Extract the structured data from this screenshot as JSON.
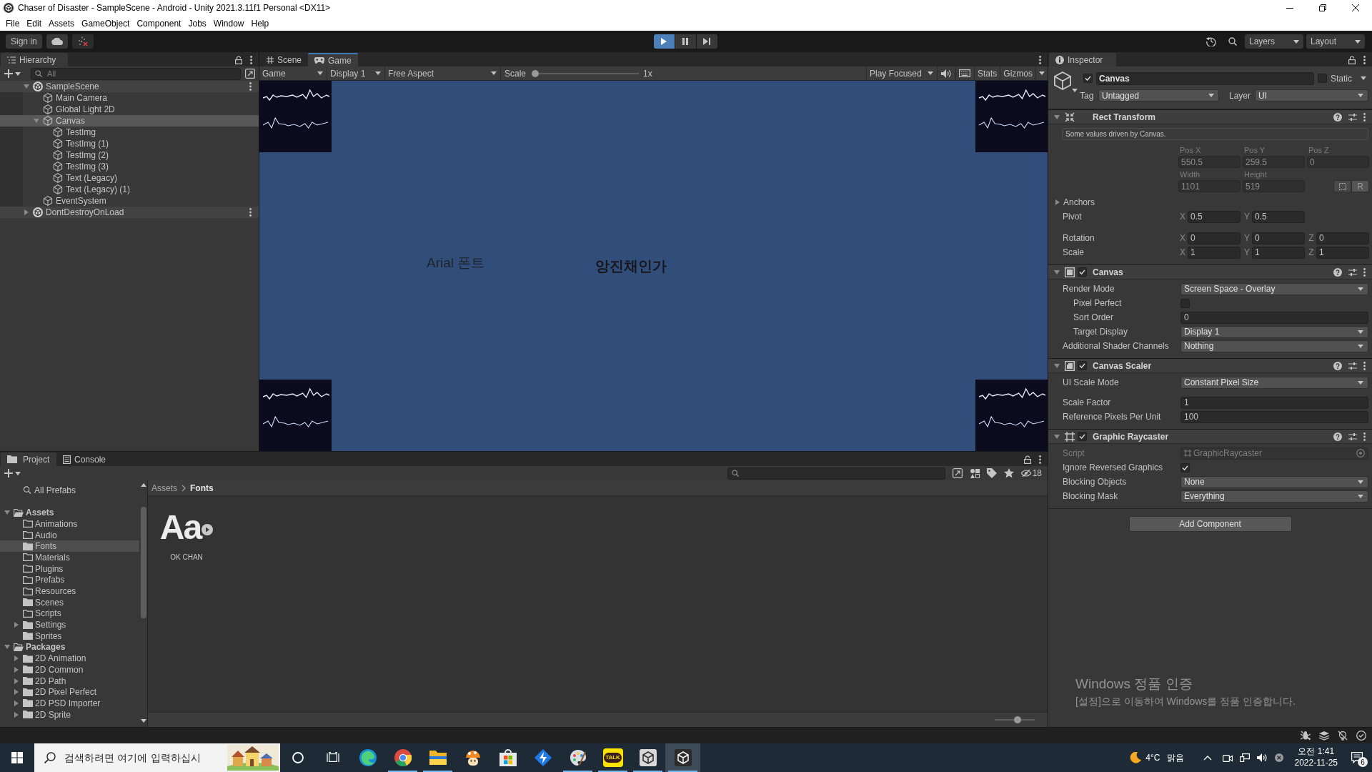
{
  "window": {
    "title": "Chaser of Disaster - SampleScene - Android - Unity 2021.3.11f1 Personal <DX11>"
  },
  "menu": [
    "File",
    "Edit",
    "Assets",
    "GameObject",
    "Component",
    "Jobs",
    "Window",
    "Help"
  ],
  "toolbar": {
    "sign_in": "Sign in",
    "playback": [
      {
        "kind": "play",
        "selected": true
      },
      {
        "kind": "pause",
        "selected": false
      },
      {
        "kind": "step",
        "selected": false
      }
    ],
    "layers": "Layers",
    "layout": "Layout"
  },
  "hierarchy": {
    "tabs": [
      {
        "label": "Hierarchy",
        "selected": true
      }
    ],
    "search": {
      "placeholder": "All"
    },
    "items": [
      {
        "label": "SampleScene",
        "kind": "scene",
        "expanded": true,
        "selected": false,
        "children": [
          {
            "label": "Main Camera",
            "kind": "object",
            "selected": false
          },
          {
            "label": "Global Light 2D",
            "kind": "object",
            "selected": false
          },
          {
            "label": "Canvas",
            "kind": "object",
            "expanded": true,
            "selected": true,
            "children": [
              {
                "label": "TestImg",
                "kind": "object",
                "selected": false
              },
              {
                "label": "TestImg (1)",
                "kind": "object",
                "selected": false
              },
              {
                "label": "TestImg (2)",
                "kind": "object",
                "selected": false
              },
              {
                "label": "TestImg (3)",
                "kind": "object",
                "selected": false
              },
              {
                "label": "Text (Legacy)",
                "kind": "object",
                "selected": false
              },
              {
                "label": "Text (Legacy) (1)",
                "kind": "object",
                "selected": false
              }
            ]
          },
          {
            "label": "EventSystem",
            "kind": "object",
            "selected": false
          }
        ]
      },
      {
        "label": "DontDestroyOnLoad",
        "kind": "scene",
        "expanded": false,
        "selected": false
      }
    ]
  },
  "game_view": {
    "tabs": [
      {
        "label": "Scene",
        "kind": "scene",
        "selected": false
      },
      {
        "label": "Game",
        "kind": "game",
        "selected": true
      }
    ],
    "controls": {
      "view": "Game",
      "display": "Display 1",
      "aspect": "Free Aspect",
      "scale_label": "Scale",
      "scale": {
        "level": 0
      },
      "scale_value": "1x",
      "play_mode": "Play Focused",
      "stats": "Stats",
      "gizmos": "Gizmos"
    },
    "texts": [
      {
        "text": "Arial 폰트",
        "bold": false
      },
      {
        "text": "앙진채인가",
        "bold": true
      }
    ]
  },
  "inspector": {
    "tabs": [
      {
        "label": "Inspector",
        "selected": true
      }
    ],
    "object": {
      "active": true,
      "name": "Canvas",
      "static": false,
      "static_label": "Static",
      "tag_label": "Tag",
      "tag": "Untagged",
      "layer_label": "Layer",
      "layer": "UI"
    },
    "rect_transform": {
      "title": "Rect Transform",
      "expanded": true,
      "note": "Some values driven by Canvas.",
      "driven": true,
      "position": [
        {
          "label": "Pos X",
          "value": "550.5"
        },
        {
          "label": "Pos Y",
          "value": "259.5"
        },
        {
          "label": "Pos Z",
          "value": "0"
        }
      ],
      "size": [
        {
          "label": "Width",
          "value": "1101"
        },
        {
          "label": "Height",
          "value": "519"
        }
      ],
      "raw_button": "R",
      "anchors": {
        "label": "Anchors",
        "expanded": false
      },
      "vectors": [
        {
          "label": "Pivot",
          "fields": [
            {
              "axis": "X",
              "value": "0.5"
            },
            {
              "axis": "Y",
              "value": "0.5"
            }
          ]
        },
        {
          "label": "Rotation",
          "fields": [
            {
              "axis": "X",
              "value": "0"
            },
            {
              "axis": "Y",
              "value": "0"
            },
            {
              "axis": "Z",
              "value": "0"
            }
          ]
        },
        {
          "label": "Scale",
          "fields": [
            {
              "axis": "X",
              "value": "1"
            },
            {
              "axis": "Y",
              "value": "1"
            },
            {
              "axis": "Z",
              "value": "1"
            }
          ]
        }
      ]
    },
    "components": [
      {
        "kind": "canvas",
        "title": "Canvas",
        "enabled": true,
        "expanded": true,
        "properties": [
          {
            "kind": "dropdown",
            "label": "Render Mode",
            "value": "Screen Space - Overlay",
            "children": [
              {
                "kind": "checkbox",
                "label": "Pixel Perfect",
                "checked": false
              },
              {
                "kind": "number",
                "label": "Sort Order",
                "value": "0"
              },
              {
                "kind": "dropdown",
                "label": "Target Display",
                "value": "Display 1"
              }
            ]
          },
          {
            "kind": "dropdown",
            "label": "Additional Shader Channels",
            "value": "Nothing"
          }
        ]
      },
      {
        "kind": "canvas-scaler",
        "title": "Canvas Scaler",
        "enabled": true,
        "expanded": true,
        "properties": [
          {
            "kind": "dropdown",
            "label": "UI Scale Mode",
            "value": "Constant Pixel Size"
          },
          {
            "kind": "number",
            "label": "Scale Factor",
            "value": "1"
          },
          {
            "kind": "number",
            "label": "Reference Pixels Per Unit",
            "value": "100"
          }
        ]
      },
      {
        "kind": "raycaster",
        "title": "Graphic Raycaster",
        "enabled": true,
        "expanded": true,
        "properties": [
          {
            "kind": "script",
            "label": "Script",
            "value": "GraphicRaycaster"
          },
          {
            "kind": "checkbox",
            "label": "Ignore Reversed Graphics",
            "checked": true
          },
          {
            "kind": "dropdown",
            "label": "Blocking Objects",
            "value": "None"
          },
          {
            "kind": "dropdown",
            "label": "Blocking Mask",
            "value": "Everything"
          }
        ]
      }
    ],
    "add_component": "Add Component"
  },
  "project": {
    "tabs": [
      {
        "label": "Project",
        "kind": "project",
        "selected": true
      },
      {
        "label": "Console",
        "kind": "console",
        "selected": false
      }
    ],
    "hidden_count": "18",
    "favorites": [
      {
        "label": "All Prefabs",
        "selected": false
      }
    ],
    "tree": [
      {
        "label": "Assets",
        "expanded": true,
        "selected": false,
        "children": [
          {
            "label": "Animations",
            "empty": true,
            "selected": false
          },
          {
            "label": "Audio",
            "empty": true,
            "selected": false
          },
          {
            "label": "Fonts",
            "empty": false,
            "selected": true
          },
          {
            "label": "Materials",
            "empty": true,
            "selected": false
          },
          {
            "label": "Plugins",
            "empty": true,
            "selected": false
          },
          {
            "label": "Prefabs",
            "empty": true,
            "selected": false
          },
          {
            "label": "Resources",
            "empty": true,
            "selected": false
          },
          {
            "label": "Scenes",
            "empty": false,
            "selected": false
          },
          {
            "label": "Scripts",
            "empty": true,
            "selected": false
          },
          {
            "label": "Settings",
            "empty": false,
            "expanded": false,
            "selected": false
          },
          {
            "label": "Sprites",
            "empty": false,
            "selected": false
          }
        ]
      },
      {
        "label": "Packages",
        "expanded": true,
        "selected": false,
        "children": [
          {
            "label": "2D Animation",
            "empty": false,
            "expanded": false,
            "selected": false
          },
          {
            "label": "2D Common",
            "empty": false,
            "expanded": false,
            "selected": false
          },
          {
            "label": "2D Path",
            "empty": false,
            "expanded": false,
            "selected": false
          },
          {
            "label": "2D Pixel Perfect",
            "empty": false,
            "expanded": false,
            "selected": false
          },
          {
            "label": "2D PSD Importer",
            "empty": false,
            "expanded": false,
            "selected": false
          },
          {
            "label": "2D Sprite",
            "empty": false,
            "expanded": false,
            "selected": false
          }
        ]
      }
    ],
    "breadcrumb": [
      "Assets",
      "Fonts"
    ],
    "assets": [
      {
        "kind": "font",
        "preview": "Aa",
        "name": "OK CHAN"
      }
    ],
    "icon_size": {
      "level": 0.58
    }
  },
  "activation_notice": {
    "title": "Windows 정품 인증",
    "message": "[설정]으로 이동하여 Windows를 정품 인증합니다."
  },
  "taskbar": {
    "search": {
      "placeholder": "검색하려면 여기에 입력하십시"
    },
    "apps": [
      {
        "running": false,
        "selected": false
      },
      {
        "running": true,
        "selected": false
      },
      {
        "running": true,
        "selected": false
      },
      {
        "running": false,
        "selected": false
      },
      {
        "running": false,
        "selected": false
      },
      {
        "running": false,
        "selected": false
      },
      {
        "running": true,
        "selected": false
      },
      {
        "running": true,
        "selected": false,
        "label": "TALK"
      },
      {
        "running": true,
        "selected": false
      },
      {
        "running": true,
        "selected": true
      }
    ],
    "weather": {
      "temperature": "4°C",
      "condition": "맑음"
    },
    "clock": {
      "time": "오전 1:41",
      "date": "2022-11-25"
    },
    "notifications": "6"
  }
}
